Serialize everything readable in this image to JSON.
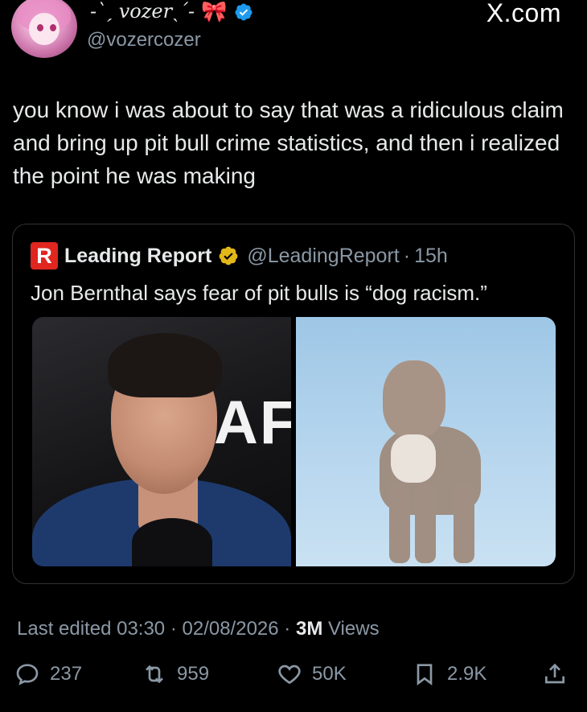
{
  "author": {
    "display_name": "-`ˏ vozerˎ´-",
    "bow_icon": "🎀",
    "verified": true,
    "handle": "@vozercozer"
  },
  "brand": "X.com",
  "tweet": {
    "text": "you know i was about to say that was a ridiculous claim and bring up pit bull crime statistics, and then i realized the point he was making"
  },
  "quoted": {
    "logo_letter": "R",
    "name": "Leading Report",
    "handle": "@LeadingReport",
    "separator": "·",
    "time": "15h",
    "text": "Jon Bernthal says fear of pit bulls is “dog racism.”",
    "left_image_sign": "AFI"
  },
  "meta": {
    "edited_label": "Last edited",
    "time": "03:30",
    "date": "02/08/2026",
    "views_count": "3M",
    "views_label": "Views",
    "dot": "·"
  },
  "actions": {
    "replies": "237",
    "reposts": "959",
    "likes": "50K",
    "bookmarks": "2.9K"
  },
  "colors": {
    "background": "#000000",
    "text": "#e7e9ea",
    "muted": "#8b98a5",
    "verified_blue": "#1d9bf0",
    "gold_badge": "#e2b719",
    "leading_report_red": "#e0261f"
  }
}
